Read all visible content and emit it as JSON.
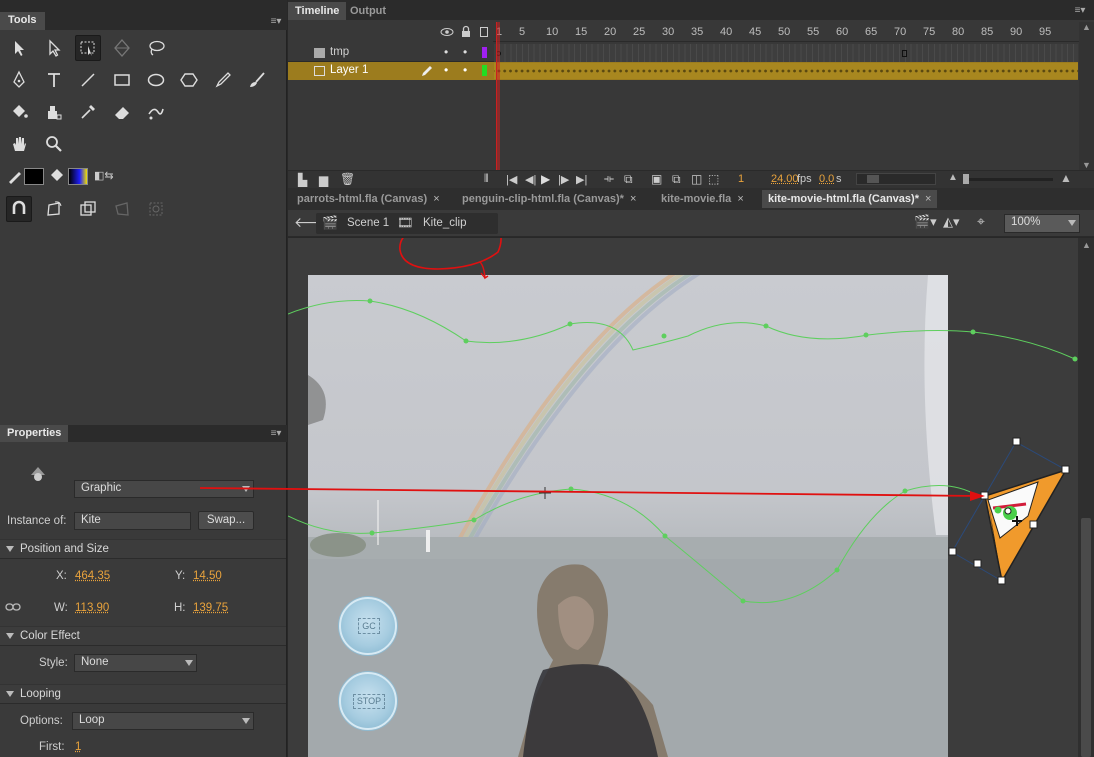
{
  "tools_panel": {
    "title": "Tools"
  },
  "timeline_panel": {
    "tabs": [
      "Timeline",
      "Output"
    ],
    "frame_numbers": [
      "1",
      "5",
      "10",
      "15",
      "20",
      "25",
      "30",
      "35",
      "40",
      "45",
      "50",
      "55",
      "60",
      "65",
      "70",
      "75",
      "80",
      "85",
      "90",
      "95"
    ],
    "layers": [
      {
        "name": "tmp",
        "selected": false,
        "color": "#a020f0"
      },
      {
        "name": "Layer 1",
        "selected": true,
        "color": "#22dd22"
      }
    ],
    "footer": {
      "current_frame": "1",
      "fps_value": "24.00",
      "fps_unit": "fps",
      "time_value": "0.0",
      "time_unit": "s"
    }
  },
  "document_tabs": [
    {
      "label": "parrots-html.fla (Canvas)",
      "active": false
    },
    {
      "label": "penguin-clip-html.fla (Canvas)*",
      "active": false
    },
    {
      "label": "kite-movie.fla",
      "active": false
    },
    {
      "label": "kite-movie-html.fla (Canvas)*",
      "active": true
    }
  ],
  "edit_bar": {
    "scene": "Scene 1",
    "symbol": "Kite_clip",
    "zoom": "100%"
  },
  "stage": {
    "buttons": [
      "GC",
      "STOP"
    ]
  },
  "properties_panel": {
    "title": "Properties",
    "instance_behavior": "Graphic",
    "instance_of_label": "Instance of:",
    "instance_of_value": "Kite",
    "swap_label": "Swap...",
    "position_size": {
      "header": "Position and Size",
      "x_label": "X:",
      "x_value": "464.35",
      "y_label": "Y:",
      "y_value": "14.50",
      "w_label": "W:",
      "w_value": "113.90",
      "h_label": "H:",
      "h_value": "139.75"
    },
    "color_effect": {
      "header": "Color Effect",
      "style_label": "Style:",
      "style_value": "None"
    },
    "looping": {
      "header": "Looping",
      "options_label": "Options:",
      "options_value": "Loop",
      "first_label": "First:",
      "first_value": "1"
    }
  },
  "colors": {
    "accent_orange": "#e9a33c",
    "selected_layer": "#9c7c1e",
    "playhead": "#cc2020",
    "annotation_red": "#e01010",
    "motion_path": "#5ecf5e"
  }
}
